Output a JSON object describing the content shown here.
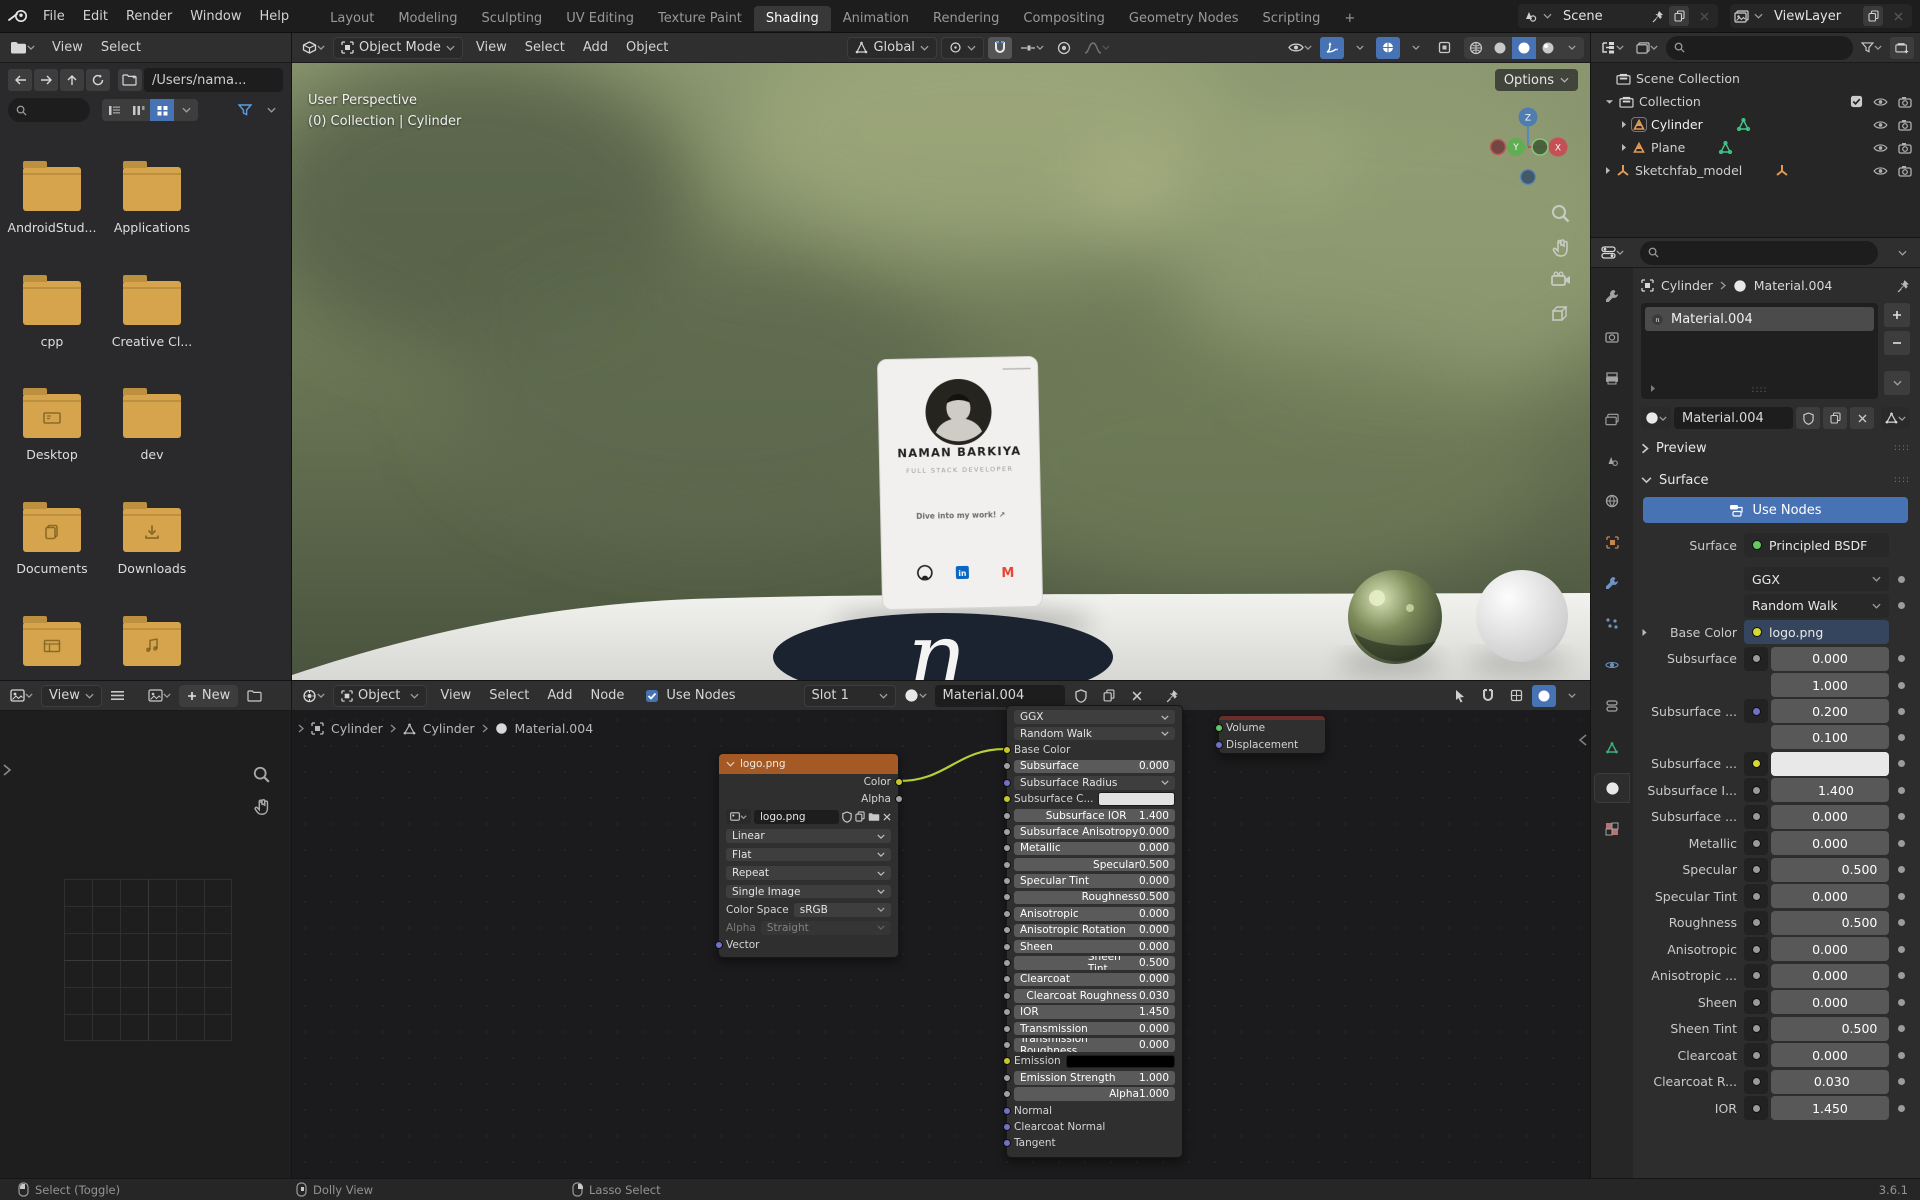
{
  "topbar": {
    "menus": [
      "File",
      "Edit",
      "Render",
      "Window",
      "Help"
    ],
    "tabs": [
      {
        "label": "Layout"
      },
      {
        "label": "Modeling"
      },
      {
        "label": "Sculpting"
      },
      {
        "label": "UV Editing"
      },
      {
        "label": "Texture Paint"
      },
      {
        "label": "Shading",
        "active": true
      },
      {
        "label": "Animation"
      },
      {
        "label": "Rendering"
      },
      {
        "label": "Compositing"
      },
      {
        "label": "Geometry Nodes"
      },
      {
        "label": "Scripting"
      },
      {
        "label": "+"
      }
    ],
    "scene": "Scene",
    "view_layer": "ViewLayer"
  },
  "file_browser": {
    "menus": [
      "View",
      "Select"
    ],
    "path": "/Users/nama...",
    "folders": [
      {
        "label": "AndroidStud...",
        "glyph": "plain"
      },
      {
        "label": "Applications",
        "glyph": "plain"
      },
      {
        "label": "cpp",
        "glyph": "plain"
      },
      {
        "label": "Creative Cl...",
        "glyph": "plain"
      },
      {
        "label": "Desktop",
        "glyph": "desktop"
      },
      {
        "label": "dev",
        "glyph": "plain"
      },
      {
        "label": "Documents",
        "glyph": "documents"
      },
      {
        "label": "Downloads",
        "glyph": "downloads"
      },
      {
        "label": "",
        "glyph": "library"
      },
      {
        "label": "",
        "glyph": "music"
      }
    ]
  },
  "viewport": {
    "mode": "Object Mode",
    "menus": [
      "View",
      "Select",
      "Add",
      "Object"
    ],
    "orientation": "Global",
    "options": "Options",
    "overlay_line1": "User Perspective",
    "overlay_line2": "(0) Collection | Cylinder",
    "axes": {
      "z": "Z",
      "y": "Y",
      "x": "X"
    },
    "card": {
      "name": "NAMAN BARKIYA",
      "role": "FULL STACK DEVELOPER",
      "tagline": "Dive into my work! ↗",
      "linkedin": "in",
      "gmail": "M"
    },
    "logo_letter": "n"
  },
  "image_editor": {
    "mode": "View",
    "new_button": "New"
  },
  "shader_editor": {
    "mode": "Object",
    "menus": [
      "View",
      "Select",
      "Add",
      "Node"
    ],
    "use_nodes": "Use Nodes",
    "slot": "Slot 1",
    "material": "Material.004",
    "breadcrumb": [
      "Cylinder",
      "Cylinder",
      "Material.004"
    ],
    "output_node": {
      "rows": [
        "Volume",
        "Displacement"
      ]
    },
    "image_node": {
      "title": "logo.png",
      "outputs": [
        {
          "label": "Color",
          "socket": "#c7c729"
        },
        {
          "label": "Alpha",
          "socket": "#a1a1a1"
        }
      ],
      "image_name": "logo.png",
      "dropdowns": [
        "Linear",
        "Flat",
        "Repeat",
        "Single Image"
      ],
      "color_space_label": "Color Space",
      "color_space": "sRGB",
      "alpha_label": "Alpha",
      "alpha_value": "Straight",
      "input_label": "Vector"
    },
    "bsdf_node": {
      "rows": [
        {
          "t": "drop",
          "label": "GGX"
        },
        {
          "t": "drop",
          "label": "Random Walk"
        },
        {
          "t": "label",
          "label": "Base Color",
          "socket": "#c7c729"
        },
        {
          "t": "val",
          "label": "Subsurface",
          "value": "0.000",
          "fill": 0,
          "socket": "#a1a1a1"
        },
        {
          "t": "drop",
          "label": "Subsurface Radius",
          "socket": "#7070c8"
        },
        {
          "t": "color",
          "label": "Subsurface C...",
          "swatch": "#e2e2e2",
          "socket": "#c7c729"
        },
        {
          "t": "val",
          "label": "Subsurface IOR",
          "value": "1.400",
          "fill": 0.09,
          "socket": "#a1a1a1"
        },
        {
          "t": "val",
          "label": "Subsurface Anisotropy",
          "value": "0.000",
          "fill": 0,
          "socket": "#a1a1a1"
        },
        {
          "t": "val",
          "label": "Metallic",
          "value": "0.000",
          "fill": 0,
          "socket": "#a1a1a1"
        },
        {
          "t": "val",
          "label": "Specular",
          "value": "0.500",
          "fill": 0.5,
          "socket": "#a1a1a1"
        },
        {
          "t": "val",
          "label": "Specular Tint",
          "value": "0.000",
          "fill": 0,
          "socket": "#a1a1a1"
        },
        {
          "t": "val",
          "label": "Roughness",
          "value": "0.500",
          "fill": 0.5,
          "socket": "#a1a1a1"
        },
        {
          "t": "val",
          "label": "Anisotropic",
          "value": "0.000",
          "fill": 0,
          "socket": "#a1a1a1"
        },
        {
          "t": "val",
          "label": "Anisotropic Rotation",
          "value": "0.000",
          "fill": 0,
          "socket": "#a1a1a1"
        },
        {
          "t": "val",
          "label": "Sheen",
          "value": "0.000",
          "fill": 0,
          "socket": "#a1a1a1"
        },
        {
          "t": "val",
          "label": "Sheen Tint",
          "value": "0.500",
          "fill": 0.5,
          "socket": "#a1a1a1"
        },
        {
          "t": "val",
          "label": "Clearcoat",
          "value": "0.000",
          "fill": 0,
          "socket": "#a1a1a1"
        },
        {
          "t": "val",
          "label": "Clearcoat Roughness",
          "value": "0.030",
          "fill": 0.03,
          "socket": "#a1a1a1"
        },
        {
          "t": "val",
          "label": "IOR",
          "value": "1.450",
          "fill": 0,
          "socket": "#a1a1a1"
        },
        {
          "t": "val",
          "label": "Transmission",
          "value": "0.000",
          "fill": 0,
          "socket": "#a1a1a1"
        },
        {
          "t": "val",
          "label": "Transmission Roughness",
          "value": "0.000",
          "fill": 0,
          "socket": "#a1a1a1"
        },
        {
          "t": "color",
          "label": "Emission",
          "swatch": "#000000",
          "socket": "#c7c729"
        },
        {
          "t": "val",
          "label": "Emission Strength",
          "value": "1.000",
          "fill": 0,
          "socket": "#a1a1a1"
        },
        {
          "t": "val",
          "label": "Alpha",
          "value": "1.000",
          "fill": 1,
          "socket": "#a1a1a1"
        },
        {
          "t": "label",
          "label": "Normal",
          "socket": "#7070c8"
        },
        {
          "t": "label",
          "label": "Clearcoat Normal",
          "socket": "#7070c8"
        },
        {
          "t": "label",
          "label": "Tangent",
          "socket": "#7070c8"
        }
      ]
    }
  },
  "outliner": {
    "root": "Scene Collection",
    "items": [
      {
        "label": "Collection",
        "icon": "collection",
        "depth": 1,
        "arrow": "down",
        "checkbox": true,
        "eye": true,
        "camera": true
      },
      {
        "label": "Cylinder",
        "icon": "mesh",
        "depth": 2,
        "arrow": "right",
        "meshdata": true,
        "eye": true,
        "camera": true,
        "selected": true
      },
      {
        "label": "Plane",
        "icon": "mesh",
        "depth": 2,
        "arrow": "right",
        "meshdata": true,
        "eye": true,
        "camera": true
      },
      {
        "label": "Sketchfab_model",
        "icon": "empty",
        "depth": 1,
        "arrow": "right",
        "emptydata": true,
        "eye": true,
        "camera": true
      }
    ]
  },
  "properties": {
    "breadcrumb": [
      "Cylinder",
      "Material.004"
    ],
    "slot_item": "Material.004",
    "material_name": "Material.004",
    "panel_preview": "Preview",
    "panel_surface": "Surface",
    "use_nodes": "Use Nodes",
    "surface_label": "Surface",
    "surface_value": "Principled BSDF",
    "distribution": "GGX",
    "subsurface_method": "Random Walk",
    "base_color_label": "Base Color",
    "base_color_value": "logo.png",
    "rows": [
      {
        "t": "val",
        "label": "Subsurface",
        "value": "0.000",
        "fill": 0,
        "dot": "#9a9a9a"
      },
      {
        "t": "vec",
        "label": "Subsurface ...",
        "values": [
          "1.000",
          "0.200",
          "0.100"
        ],
        "dot": "#7070c8"
      },
      {
        "t": "color",
        "label": "Subsurface ...",
        "swatch": "#e8e8e8",
        "dot": "#d8d832"
      },
      {
        "t": "val",
        "label": "Subsurface I...",
        "value": "1.400",
        "fill": 0.1,
        "dot": "#9a9a9a"
      },
      {
        "t": "val",
        "label": "Subsurface ...",
        "value": "0.000",
        "fill": 0,
        "dot": "#9a9a9a"
      },
      {
        "t": "val",
        "label": "Metallic",
        "value": "0.000",
        "fill": 0,
        "dot": "#9a9a9a"
      },
      {
        "t": "val",
        "label": "Specular",
        "value": "0.500",
        "fill": 0.5,
        "dot": "#9a9a9a"
      },
      {
        "t": "val",
        "label": "Specular Tint",
        "value": "0.000",
        "fill": 0,
        "dot": "#9a9a9a"
      },
      {
        "t": "val",
        "label": "Roughness",
        "value": "0.500",
        "fill": 0.5,
        "dot": "#9a9a9a"
      },
      {
        "t": "val",
        "label": "Anisotropic",
        "value": "0.000",
        "fill": 0,
        "dot": "#9a9a9a"
      },
      {
        "t": "val",
        "label": "Anisotropic ...",
        "value": "0.000",
        "fill": 0,
        "dot": "#9a9a9a"
      },
      {
        "t": "val",
        "label": "Sheen",
        "value": "0.000",
        "fill": 0,
        "dot": "#9a9a9a"
      },
      {
        "t": "val",
        "label": "Sheen Tint",
        "value": "0.500",
        "fill": 0.5,
        "dot": "#9a9a9a"
      },
      {
        "t": "val",
        "label": "Clearcoat",
        "value": "0.000",
        "fill": 0,
        "dot": "#9a9a9a"
      },
      {
        "t": "val",
        "label": "Clearcoat R...",
        "value": "0.030",
        "fill": 0.03,
        "dot": "#9a9a9a"
      },
      {
        "t": "val",
        "label": "IOR",
        "value": "1.450",
        "fill": 0,
        "dot": "#9a9a9a"
      }
    ],
    "tabs": [
      "tool",
      "render",
      "output",
      "view-layer",
      "scene",
      "world",
      "object",
      "modifiers",
      "particles",
      "physics",
      "constraints",
      "data",
      "material",
      "texture"
    ],
    "active_tab": "material"
  },
  "status_bar": {
    "items": [
      {
        "icon": "lmb",
        "label": "Select (Toggle)"
      },
      {
        "icon": "mmb",
        "label": "Dolly View"
      },
      {
        "icon": "rmb",
        "label": "Lasso Select"
      }
    ],
    "version": "3.6.1"
  },
  "colors": {
    "accent": "#4772b3",
    "texture_node_header": "#a55a26",
    "folder": "#d5a44c",
    "wire": "#b5cf36"
  }
}
